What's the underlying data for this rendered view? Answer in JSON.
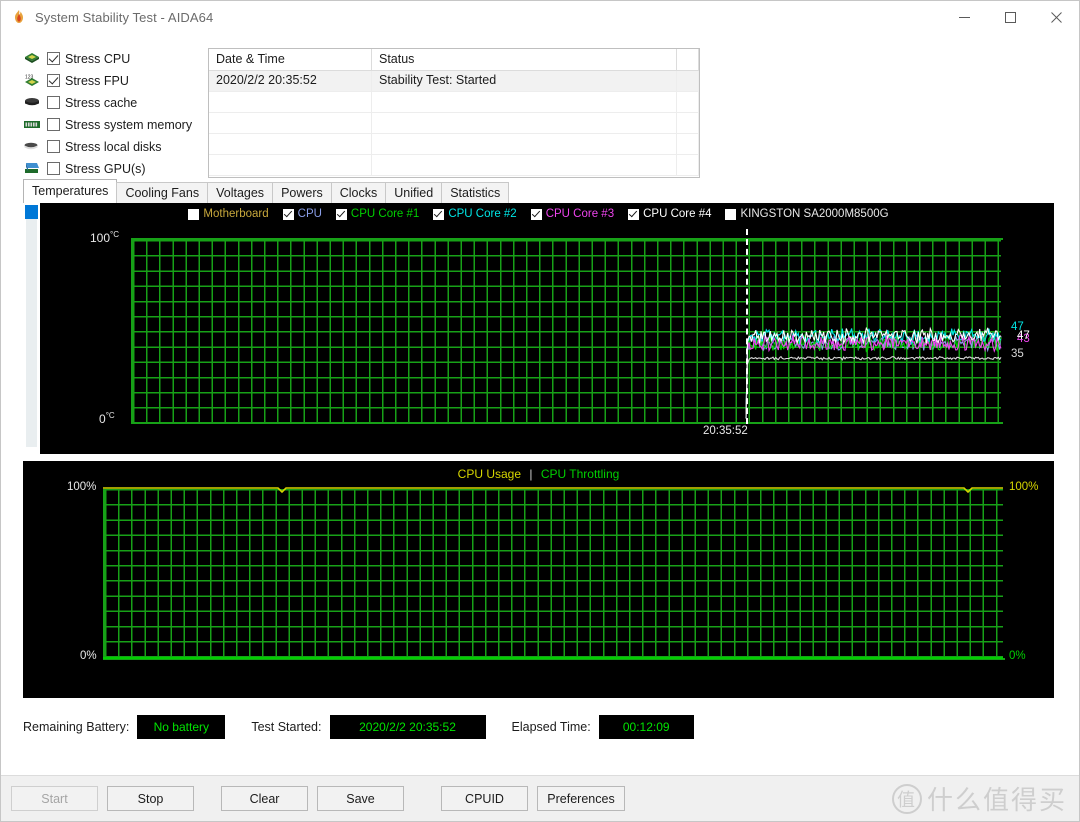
{
  "window": {
    "title": "System Stability Test - AIDA64",
    "app_icon": "flame-icon",
    "minimize_label": "—",
    "maximize_label": "□",
    "close_label": "✕"
  },
  "stress_options": [
    {
      "label": "Stress CPU",
      "checked": true,
      "icon": "cpu-chip-icon"
    },
    {
      "label": "Stress FPU",
      "checked": true,
      "icon": "fpu-chip-icon"
    },
    {
      "label": "Stress cache",
      "checked": false,
      "icon": "cache-chip-icon"
    },
    {
      "label": "Stress system memory",
      "checked": false,
      "icon": "memory-module-icon"
    },
    {
      "label": "Stress local disks",
      "checked": false,
      "icon": "hard-disk-icon"
    },
    {
      "label": "Stress GPU(s)",
      "checked": false,
      "icon": "gpu-card-icon"
    }
  ],
  "log": {
    "columns": [
      "Date & Time",
      "Status"
    ],
    "rows": [
      {
        "datetime": "2020/2/2 20:35:52",
        "status": "Stability Test: Started",
        "selected": true
      },
      {
        "datetime": "",
        "status": "",
        "selected": false
      },
      {
        "datetime": "",
        "status": "",
        "selected": false
      },
      {
        "datetime": "",
        "status": "",
        "selected": false
      },
      {
        "datetime": "",
        "status": "",
        "selected": false
      }
    ]
  },
  "tabs": [
    {
      "label": "Temperatures",
      "active": true
    },
    {
      "label": "Cooling Fans",
      "active": false
    },
    {
      "label": "Voltages",
      "active": false
    },
    {
      "label": "Powers",
      "active": false
    },
    {
      "label": "Clocks",
      "active": false
    },
    {
      "label": "Unified",
      "active": false
    },
    {
      "label": "Statistics",
      "active": false
    }
  ],
  "temperature_chart": {
    "legend": [
      {
        "label": "Motherboard",
        "checked": false,
        "color": "#c8a83c"
      },
      {
        "label": "CPU",
        "checked": true,
        "color": "#8a9ee8"
      },
      {
        "label": "CPU Core #1",
        "checked": true,
        "color": "#00d000"
      },
      {
        "label": "CPU Core #2",
        "checked": true,
        "color": "#00e5e5"
      },
      {
        "label": "CPU Core #3",
        "checked": true,
        "color": "#ee44ee"
      },
      {
        "label": "CPU Core #4",
        "checked": true,
        "color": "#ffffff"
      },
      {
        "label": "KINGSTON SA2000M8500G",
        "checked": false,
        "color": "#e8e8e8"
      }
    ],
    "y_max_label": "100",
    "y_max_unit": "°C",
    "y_min_label": "0",
    "y_min_unit": "°C",
    "time_marker_label": "20:35:52",
    "value_labels": [
      {
        "text": "47",
        "color": "#00e5e5"
      },
      {
        "text": "43",
        "color": "#ee44ee"
      },
      {
        "text": "47",
        "color": "#ffffff"
      },
      {
        "text": "35",
        "color": "#d8d8d8"
      }
    ]
  },
  "cpu_chart": {
    "title_usage": "CPU Usage",
    "title_separator": "|",
    "title_throttling": "CPU Throttling",
    "usage_color": "#d6d600",
    "throttling_color": "#00d000",
    "y_max_left": "100%",
    "y_min_left": "0%",
    "y_max_right": "100%",
    "y_min_right": "0%"
  },
  "chart_data": [
    {
      "type": "line",
      "title": "Temperatures",
      "xlabel": "",
      "ylabel": "°C",
      "ylim": [
        0,
        100
      ],
      "grid": true,
      "legend_position": "top-center",
      "time_marker": "20:35:52",
      "series": [
        {
          "name": "Motherboard",
          "color": "#c8a83c",
          "visible": false,
          "last_value": null
        },
        {
          "name": "CPU",
          "color": "#8a9ee8",
          "visible": true,
          "last_value": 43
        },
        {
          "name": "CPU Core #1",
          "color": "#00d000",
          "visible": true,
          "last_value": 43
        },
        {
          "name": "CPU Core #2",
          "color": "#00e5e5",
          "visible": true,
          "last_value": 47
        },
        {
          "name": "CPU Core #3",
          "color": "#ee44ee",
          "visible": true,
          "last_value": 43
        },
        {
          "name": "CPU Core #4",
          "color": "#ffffff",
          "visible": true,
          "last_value": 47
        },
        {
          "name": "KINGSTON SA2000M8500G",
          "color": "#d8d8d8",
          "visible": false,
          "last_value": 35
        }
      ]
    },
    {
      "type": "line",
      "title": "CPU Usage | CPU Throttling",
      "xlabel": "",
      "ylabel": "%",
      "ylim": [
        0,
        100
      ],
      "grid": true,
      "legend_position": "top-center",
      "series": [
        {
          "name": "CPU Usage",
          "color": "#d6d600",
          "visible": true,
          "last_value": 100
        },
        {
          "name": "CPU Throttling",
          "color": "#00d000",
          "visible": true,
          "last_value": 0
        }
      ]
    }
  ],
  "status": {
    "battery_label": "Remaining Battery:",
    "battery_value": "No battery",
    "started_label": "Test Started:",
    "started_value": "2020/2/2 20:35:52",
    "elapsed_label": "Elapsed Time:",
    "elapsed_value": "00:12:09"
  },
  "buttons": {
    "start": "Start",
    "stop": "Stop",
    "clear": "Clear",
    "save": "Save",
    "cpuid": "CPUID",
    "preferences": "Preferences"
  },
  "watermark": {
    "mark": "值",
    "text": "什么值得买"
  }
}
